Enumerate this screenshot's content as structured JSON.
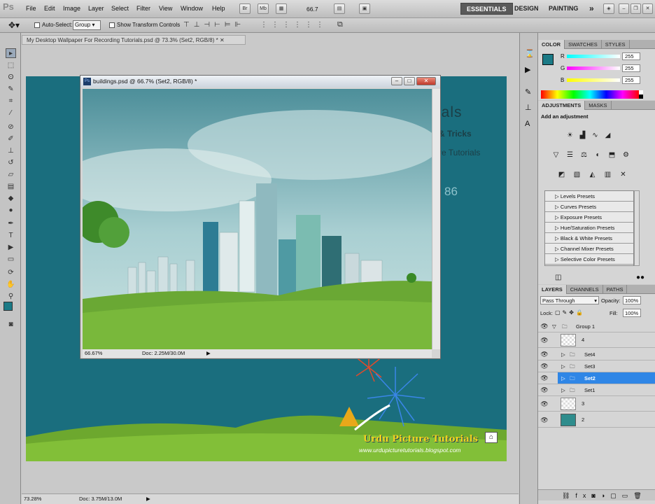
{
  "app": {
    "logo": "Ps"
  },
  "menu": [
    "File",
    "Edit",
    "Image",
    "Layer",
    "Select",
    "Filter",
    "View",
    "Window",
    "Help"
  ],
  "toolbar": {
    "bridge": "Br",
    "minibridge": "Mb",
    "zoom": "66.7"
  },
  "workspaces": {
    "essentials": "ESSENTIALS",
    "design": "DESIGN",
    "painting": "PAINTING",
    "more": "»"
  },
  "options": {
    "auto_select_label": "Auto-Select:",
    "auto_select_value": "Group",
    "transform_label": "Show Transform Controls"
  },
  "main_doc": {
    "tab_title": "My Desktop Wallpaper For Recording Tutorials.psd @ 73.3% (Set2, RGB/8) *",
    "zoom": "73.28%",
    "doc_size": "Doc: 3.75M/13.0M",
    "canvas_text": {
      "line1": "rials",
      "line2": "& Tricks",
      "line3": "re Tutorials",
      "line4": "86"
    },
    "brand_name": "Urdu Picture Tutorials",
    "brand_url": "www.urdupicturetutorials.blogspot.com"
  },
  "buildings_window": {
    "title": "buildings.psd @ 66.7% (Set2, RGB/8) *",
    "zoom": "66.67%",
    "doc_size": "Doc: 2.25M/30.0M"
  },
  "color_panel": {
    "tabs": [
      "COLOR",
      "SWATCHES",
      "STYLES"
    ],
    "r_label": "R",
    "g_label": "G",
    "b_label": "B",
    "r": "255",
    "g": "255",
    "b": "255",
    "fg_color": "#1b7a86"
  },
  "adjustments_panel": {
    "tabs": [
      "ADJUSTMENTS",
      "MASKS"
    ],
    "heading": "Add an adjustment",
    "presets": [
      "Levels Presets",
      "Curves Presets",
      "Exposure Presets",
      "Hue/Saturation Presets",
      "Black & White Presets",
      "Channel Mixer Presets",
      "Selective Color Presets"
    ]
  },
  "layers_panel": {
    "tabs": [
      "LAYERS",
      "CHANNELS",
      "PATHS"
    ],
    "blend_mode": "Pass Through",
    "opacity_label": "Opacity:",
    "opacity": "100%",
    "lock_label": "Lock:",
    "fill_label": "Fill:",
    "fill": "100%",
    "layers": [
      {
        "name": "Group 1",
        "selected": false
      },
      {
        "name": "4",
        "selected": false
      },
      {
        "name": "Set4",
        "selected": false
      },
      {
        "name": "Set3",
        "selected": false
      },
      {
        "name": "Set2",
        "selected": true
      },
      {
        "name": "Set1",
        "selected": false
      },
      {
        "name": "3",
        "selected": false
      },
      {
        "name": "2",
        "selected": false
      }
    ]
  },
  "colors": {
    "accent": "#2f7fd8",
    "canvas_teal": "#1a6e7e",
    "selected_row": "#2f86e6"
  }
}
